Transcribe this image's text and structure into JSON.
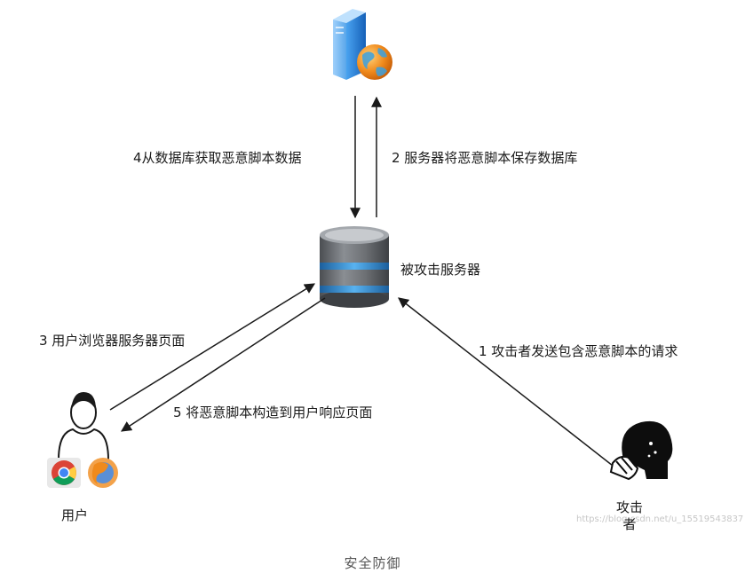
{
  "labels": {
    "step4": "4从数据库获取恶意脚本数据",
    "step2": "2 服务器将恶意脚本保存数据库",
    "server": "被攻击服务器",
    "step3": "3 用户浏览器服务器页面",
    "step1": "1 攻击者发送包含恶意脚本的请求",
    "step5": "5 将恶意脚本构造到用户响应页面",
    "user": "用户",
    "attacker_line1": "攻击",
    "attacker_line2": "者"
  },
  "watermark": "https://blog.csdn.net/u_15519543837",
  "caption": "安全防御",
  "icons": {
    "web_server": "web-server-globe-icon",
    "database": "database-icon",
    "user": "user-person-icon",
    "chrome": "chrome-browser-icon",
    "firefox": "firefox-browser-icon",
    "attacker": "hacker-attacker-icon"
  },
  "colors": {
    "arrow": "#1a1a1a",
    "server_blue": "#1e7bd8",
    "globe_orange": "#f08a1c",
    "db_gray": "#6e7175",
    "db_ring": "#2f86c9"
  }
}
